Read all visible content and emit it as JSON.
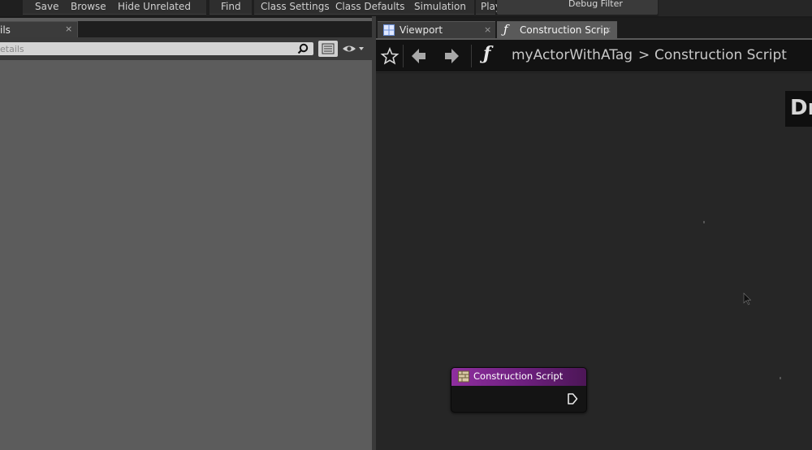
{
  "toolbar": {
    "items": [
      "Save",
      "Browse",
      "Hide Unrelated",
      "Find",
      "Class Settings",
      "Class Defaults",
      "Simulation",
      "Play"
    ],
    "debug_filter": "Debug Filter"
  },
  "details": {
    "tab_label": "ils",
    "tab_close": "×",
    "search_placeholder": "etails",
    "icons": [
      "search-icon",
      "list-view-icon",
      "eye-icon"
    ]
  },
  "editor": {
    "tabs": [
      {
        "label": "Viewport",
        "close": "×",
        "icon": "viewport-icon"
      },
      {
        "label": "Construction Scrip",
        "close": "×",
        "icon": "function-icon"
      }
    ],
    "nav_icons": [
      "star-icon",
      "back-arrow-icon",
      "forward-arrow-icon",
      "function-icon"
    ],
    "breadcrumb": {
      "parent": "myActorWithATag",
      "separator": ">",
      "current": "Construction Script"
    },
    "graph_label": "Dr",
    "node": {
      "title": "Construction Script",
      "header_color": "#7a2a8c"
    }
  },
  "colors": {
    "graph_bg": "#262626",
    "details_bg": "#5c5c5c",
    "node_header": "#8f2f9f"
  }
}
